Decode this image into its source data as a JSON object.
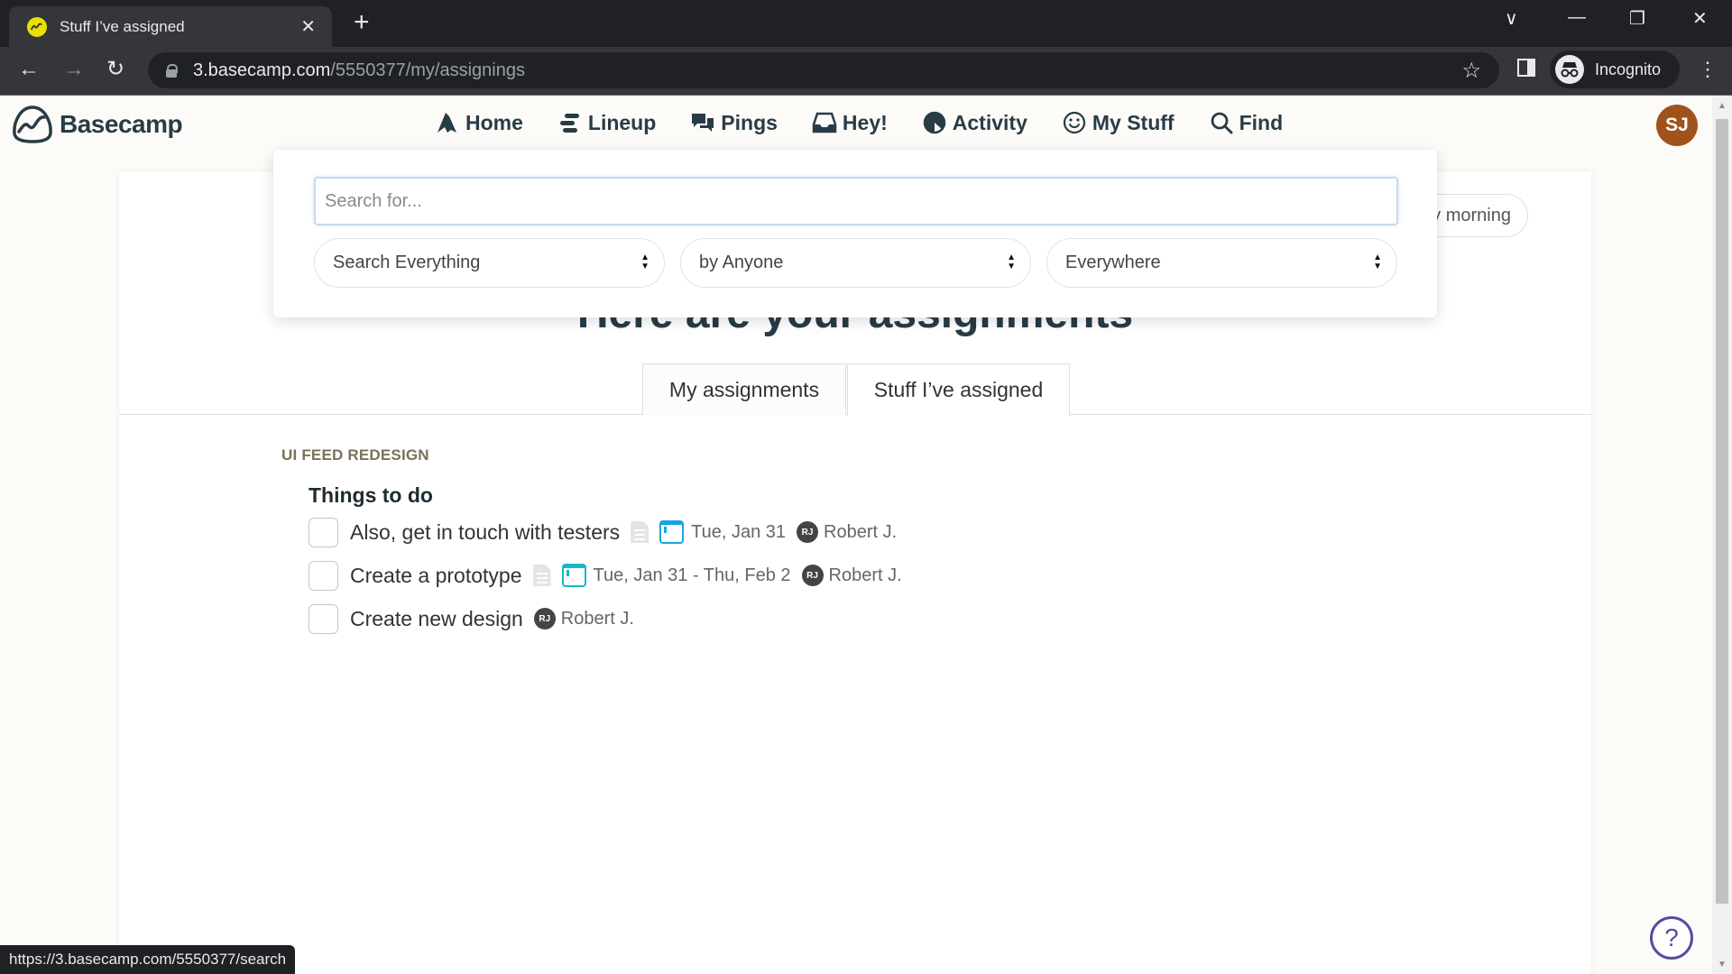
{
  "browser": {
    "tab_title": "Stuff I’ve assigned",
    "url_host": "3.basecamp.com",
    "url_path": "/5550377/my/assignings",
    "profile_label": "Incognito",
    "status_url": "https://3.basecamp.com/5550377/search",
    "icons": {
      "back": "←",
      "forward": "→",
      "reload": "↻",
      "star": "☆",
      "tab_close": "✕",
      "new_tab": "+",
      "tab_search": "∨",
      "minimize": "—",
      "restore": "❐",
      "close": "✕",
      "menu": "⋮"
    }
  },
  "app": {
    "logo_text": "Basecamp",
    "nav": [
      {
        "label": "Home",
        "icon": "home-icon"
      },
      {
        "label": "Lineup",
        "icon": "lineup-icon"
      },
      {
        "label": "Pings",
        "icon": "pings-icon"
      },
      {
        "label": "Hey!",
        "icon": "hey-icon"
      },
      {
        "label": "Activity",
        "icon": "activity-icon"
      },
      {
        "label": "My Stuff",
        "icon": "my-stuff-icon"
      },
      {
        "label": "Find",
        "icon": "search-icon"
      }
    ],
    "user_initials": "SJ",
    "help_label": "?"
  },
  "search": {
    "placeholder": "Search for...",
    "value": "",
    "type_filter": "Search Everything",
    "person_filter": "by Anyone",
    "location_filter": "Everywhere"
  },
  "page": {
    "schedule_pill": "onday morning",
    "title": "Here are your assignments",
    "tabs": [
      {
        "label": "My assignments",
        "active": false
      },
      {
        "label": "Stuff I’ve assigned",
        "active": true
      }
    ],
    "project": "UI FEED REDESIGN",
    "list_title": "Things to do",
    "todos": [
      {
        "title": "Also, get in touch with testers",
        "has_notes": true,
        "due": "Tue, Jan 31",
        "assignee_initials": "RJ",
        "assignee": "Robert J."
      },
      {
        "title": "Create a prototype",
        "has_notes": true,
        "due": "Tue, Jan 31 - Thu, Feb 2",
        "assignee_initials": "RJ",
        "assignee": "Robert J."
      },
      {
        "title": "Create new design",
        "has_notes": false,
        "due": "",
        "assignee_initials": "RJ",
        "assignee": "Robert J."
      }
    ]
  },
  "colors": {
    "avatar_sj": "#a0521b",
    "calendar_blue": "#1aa3e0",
    "calendar_teal": "#19b9c4",
    "help_purple": "#5b4a9e",
    "project_label": "#7d6f5a"
  }
}
